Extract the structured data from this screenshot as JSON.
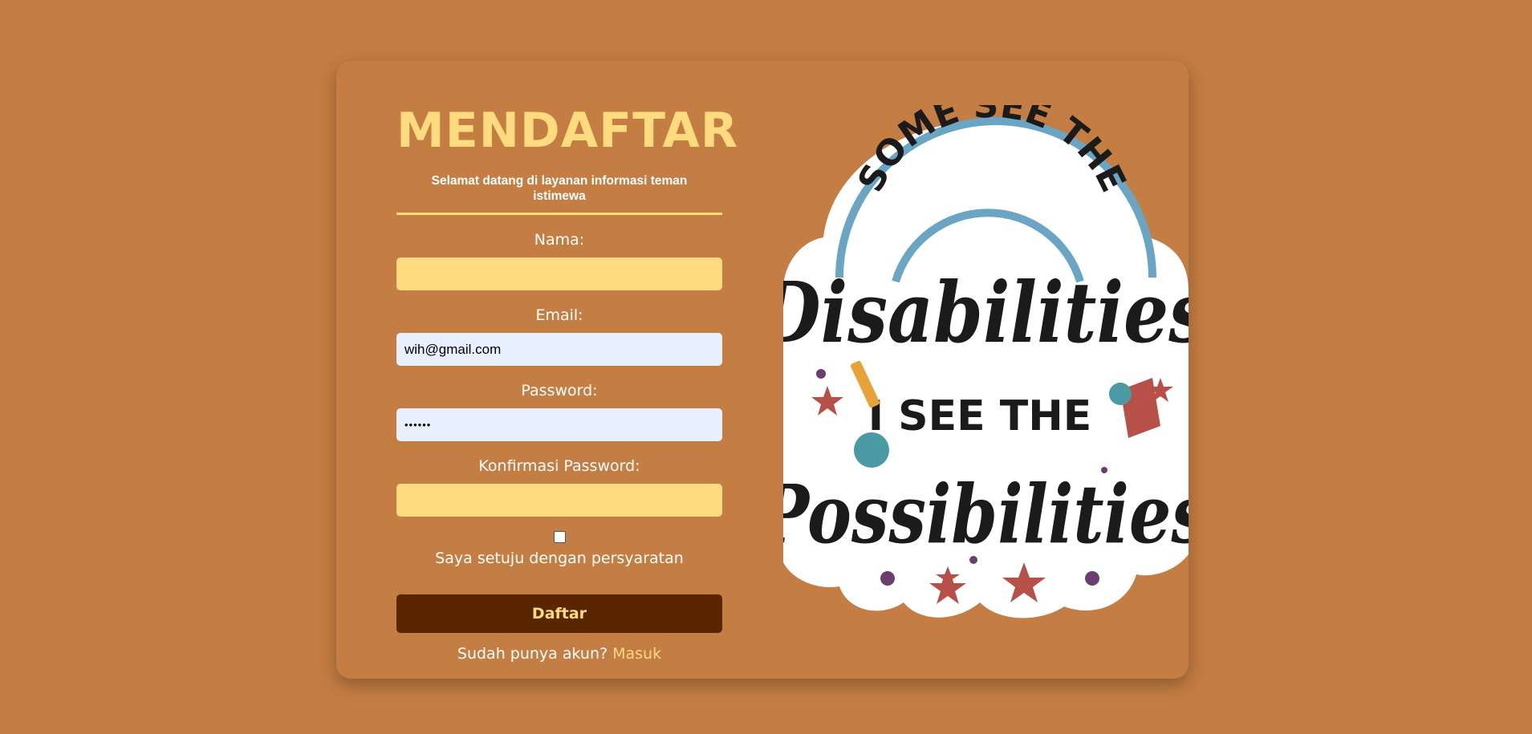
{
  "form": {
    "title": "MENDAFTAR",
    "subtitle": "Selamat datang di layanan informasi teman istimewa",
    "name_label": "Nama:",
    "name_value": "",
    "email_label": "Email:",
    "email_value": "wih@gmail.com",
    "password_label": "Password:",
    "password_value": "••••••",
    "confirm_label": "Konfirmasi Password:",
    "confirm_value": "",
    "agree_checked": false,
    "agree_label": "Saya setuju dengan persyaratan",
    "submit_label": "Daftar",
    "login_prompt": "Sudah punya akun? ",
    "login_link": "Masuk"
  },
  "sticker": {
    "line1": "SOME SEE THE",
    "line2": "Disabilities",
    "line3": "I SEE THE",
    "line4": "Possibilities"
  },
  "colors": {
    "background": "#c47d42",
    "accent": "#ffdb7f",
    "button": "#5a2600",
    "autofill": "#e8f0fe"
  }
}
